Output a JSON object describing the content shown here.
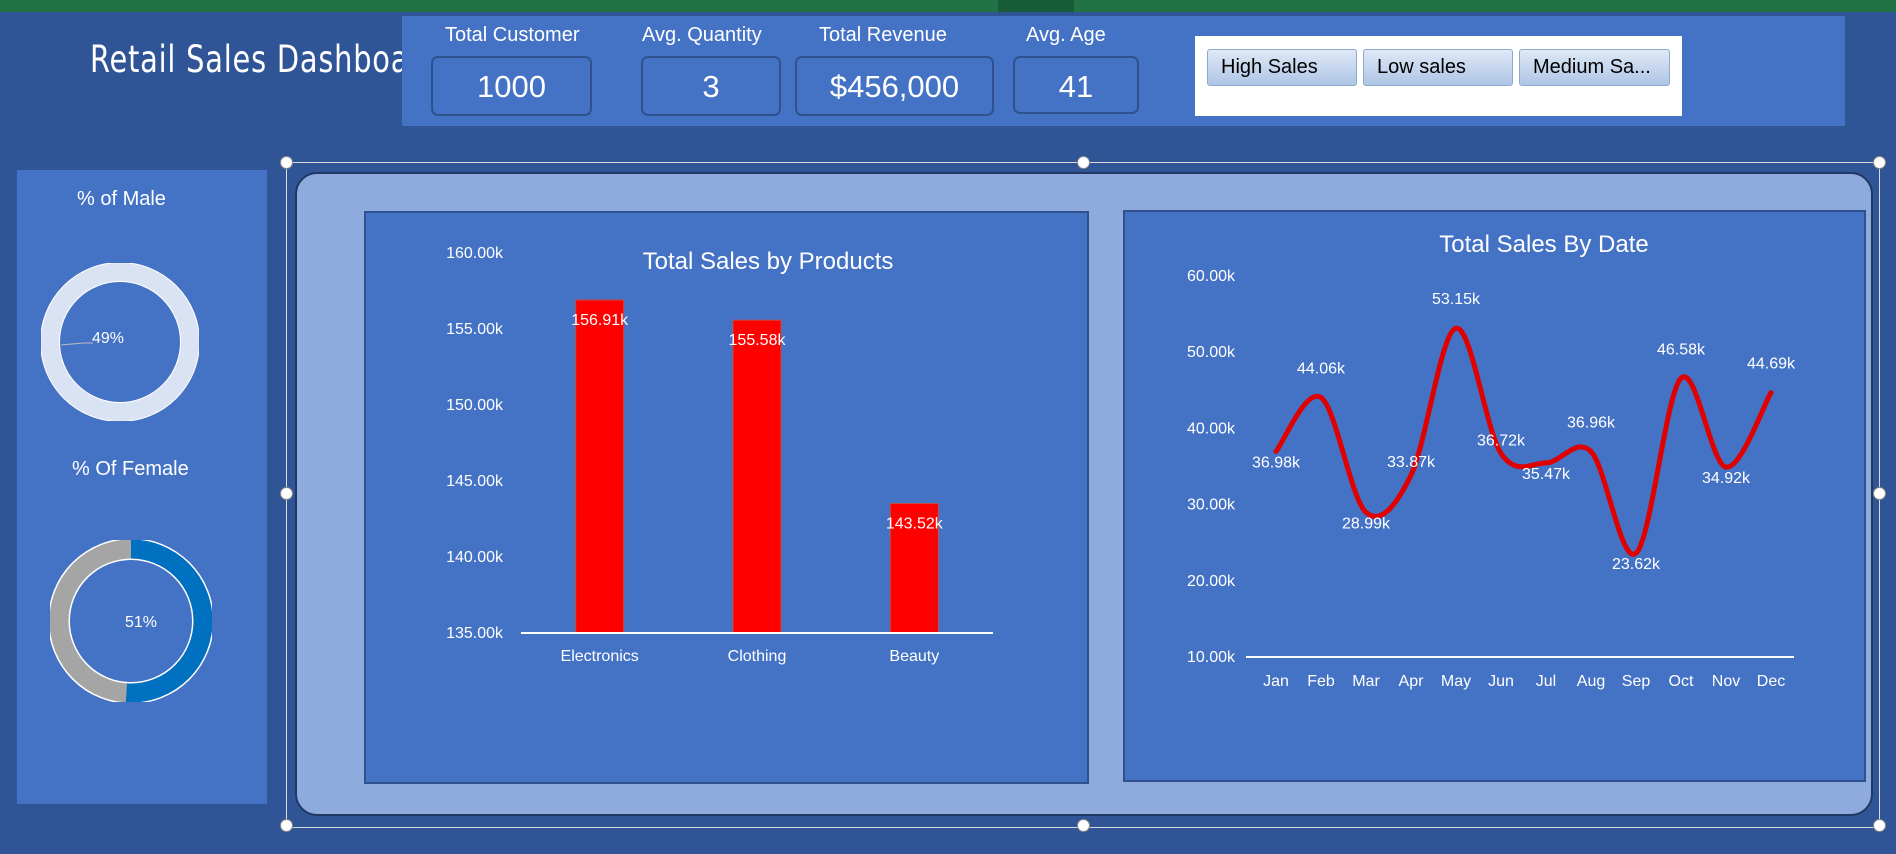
{
  "dashboard": {
    "title": "Retail  Sales Dashboard"
  },
  "kpis": [
    {
      "label": "Total  Customer",
      "value": "1000"
    },
    {
      "label": "Avg.  Quantity",
      "value": "3"
    },
    {
      "label": "Total Revenue",
      "value": "$456,000"
    },
    {
      "label": "Avg. Age",
      "value": "41"
    }
  ],
  "slicer": {
    "buttons": [
      "High Sales",
      "Low sales",
      "Medium Sa..."
    ]
  },
  "gender": {
    "male": {
      "title": "% of Male",
      "percent_label": "49%",
      "value": 49,
      "color": "#ed7d31",
      "track_color": "#dae3f3"
    },
    "female": {
      "title": "% Of Female",
      "percent_label": "51%",
      "value": 51,
      "color": "#0070c0",
      "track_color": "#a5a5a5"
    }
  },
  "colors": {
    "bar": "#ff0000",
    "line": "#e00000"
  },
  "chart_data": [
    {
      "type": "bar",
      "title": "Total Sales by Products",
      "categories": [
        "Electronics",
        "Clothing",
        "Beauty"
      ],
      "values": [
        156910,
        155580,
        143520
      ],
      "data_labels": [
        "156.91k",
        "155.58k",
        "143.52k"
      ],
      "ylim": [
        135000,
        160000
      ],
      "y_ticks": [
        "135.00k",
        "140.00k",
        "145.00k",
        "150.00k",
        "155.00k",
        "160.00k"
      ],
      "grid": false,
      "legend": "none"
    },
    {
      "type": "line",
      "title": "Total Sales By Date",
      "categories": [
        "Jan",
        "Feb",
        "Mar",
        "Apr",
        "May",
        "Jun",
        "Jul",
        "Aug",
        "Sep",
        "Oct",
        "Nov",
        "Dec"
      ],
      "values": [
        36980,
        44060,
        28990,
        33870,
        53150,
        36720,
        35470,
        36960,
        23620,
        46580,
        34920,
        44690
      ],
      "data_labels": [
        "36.98k",
        "44.06k",
        "28.99k",
        "33.87k",
        "53.15k",
        "36.72k",
        "35.47k",
        "36.96k",
        "23.62k",
        "46.58k",
        "34.92k",
        "44.69k"
      ],
      "ylim": [
        10000,
        60000
      ],
      "y_ticks": [
        "10.00k",
        "20.00k",
        "30.00k",
        "40.00k",
        "50.00k",
        "60.00k"
      ],
      "smooth": true,
      "grid": false,
      "legend": "none"
    }
  ]
}
